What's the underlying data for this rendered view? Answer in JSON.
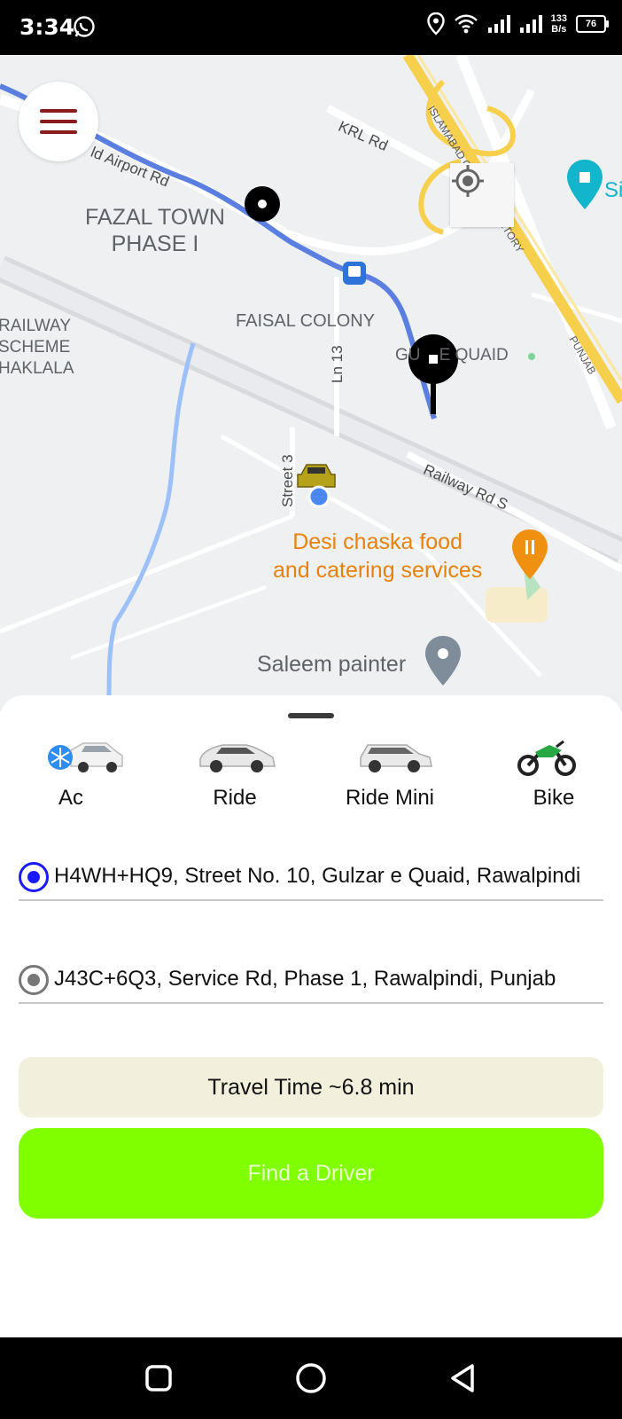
{
  "status_bar": {
    "time": "3:34",
    "speed_value": "133",
    "speed_unit": "B/s",
    "battery": "76",
    "icons": [
      "whatsapp-icon",
      "location-pin-icon",
      "wifi-icon",
      "signal-icon",
      "signal-icon"
    ]
  },
  "map": {
    "labels": {
      "airport_rd": "ld Airport Rd",
      "krl_rd": "KRL Rd",
      "fazal_town_1": "FAZAL TOWN",
      "fazal_town_2": "PHASE I",
      "railway_1": "RAILWAY",
      "railway_2": "SCHEME",
      "railway_3": "HAKLALA",
      "faisal_colony": "FAISAL COLONY",
      "ln13": "Ln 13",
      "gulzar_quaid": "GU    E QUAID",
      "street3": "Street 3",
      "railway_rd_s": "Railway Rd S",
      "islamabad": "ISLAMABAD CAPITAL TERRITORY",
      "punjab": "PUNJAB",
      "si": "Si",
      "desi_1": "Desi chaska food",
      "desi_2": "and catering services",
      "saleem": "Saleem painter"
    },
    "colors": {
      "route": "#5b7fe0",
      "highway": "#f6cf4c",
      "water": "#9cc0f9",
      "poi_food": "#e8820c"
    }
  },
  "vehicles": [
    {
      "label": "Ac",
      "icon": "ac-car-icon"
    },
    {
      "label": "Ride",
      "icon": "car-icon"
    },
    {
      "label": "Ride Mini",
      "icon": "mini-car-icon"
    },
    {
      "label": "Bike",
      "icon": "motorbike-icon"
    }
  ],
  "pickup": {
    "address": "H4WH+HQ9, Street No. 10, Gulzar e Quaid, Rawalpindi"
  },
  "dropoff": {
    "address": "J43C+6Q3, Service Rd, Phase 1, Rawalpindi, Punjab"
  },
  "travel_time": "Travel Time ~6.8 min",
  "find_driver_label": "Find a Driver",
  "accent_colors": {
    "menu": "#8b1a1a",
    "button": "#80ff00",
    "travel_bg": "#f2f0dc",
    "radio_active": "#1a1aff"
  }
}
